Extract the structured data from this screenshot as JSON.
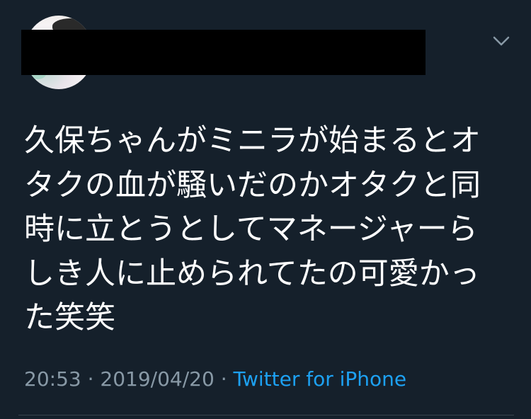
{
  "tweet": {
    "text": "久保ちゃんがミニラが始まるとオタクの血が騒いだのかオタクと同時に立とうとしてマネージャーらしき人に止められてたの可愛かった笑笑",
    "time": "20:53",
    "separator1": " · ",
    "date": "2019/04/20",
    "separator2": " · ",
    "source": "Twitter for iPhone"
  },
  "colors": {
    "background": "#15202b",
    "text": "#ffffff",
    "meta": "#8899a6",
    "link": "#1da1f2"
  },
  "icons": {
    "more": "chevron-down-icon"
  }
}
